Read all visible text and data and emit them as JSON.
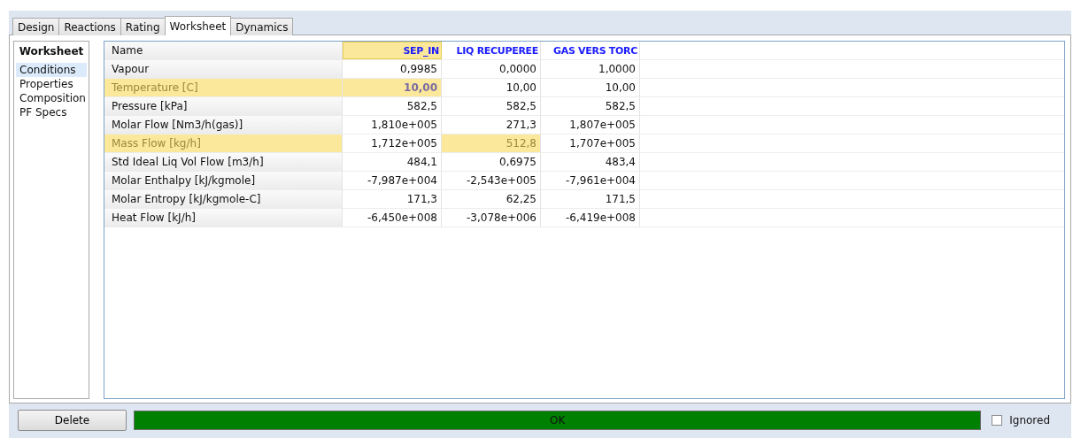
{
  "tabs": [
    {
      "label": "Design",
      "selected": false
    },
    {
      "label": "Reactions",
      "selected": false
    },
    {
      "label": "Rating",
      "selected": false
    },
    {
      "label": "Worksheet",
      "selected": true
    },
    {
      "label": "Dynamics",
      "selected": false
    }
  ],
  "sidebar": {
    "title": "Worksheet",
    "items": [
      {
        "label": "Conditions",
        "selected": true
      },
      {
        "label": "Properties",
        "selected": false
      },
      {
        "label": "Composition",
        "selected": false
      },
      {
        "label": "PF Specs",
        "selected": false
      }
    ]
  },
  "table": {
    "name_header": "Name",
    "columns": [
      {
        "label": "SEP_IN",
        "highlighted": true
      },
      {
        "label": "LIQ RECUPEREE",
        "highlighted": false
      },
      {
        "label": "GAS VERS TORC",
        "highlighted": false
      }
    ],
    "rows": [
      {
        "label": "Vapour",
        "highlighted": false,
        "cells": [
          {
            "value": "0,9985",
            "highlighted": false,
            "bold": false
          },
          {
            "value": "0,0000",
            "highlighted": false,
            "bold": false
          },
          {
            "value": "1,0000",
            "highlighted": false,
            "bold": false
          }
        ]
      },
      {
        "label": "Temperature [C]",
        "highlighted": true,
        "cells": [
          {
            "value": "10,00",
            "highlighted": true,
            "bold": true
          },
          {
            "value": "10,00",
            "highlighted": false,
            "bold": false
          },
          {
            "value": "10,00",
            "highlighted": false,
            "bold": false
          }
        ]
      },
      {
        "label": "Pressure [kPa]",
        "highlighted": false,
        "cells": [
          {
            "value": "582,5",
            "highlighted": false,
            "bold": false
          },
          {
            "value": "582,5",
            "highlighted": false,
            "bold": false
          },
          {
            "value": "582,5",
            "highlighted": false,
            "bold": false
          }
        ]
      },
      {
        "label": "Molar Flow [Nm3/h(gas)]",
        "highlighted": false,
        "cells": [
          {
            "value": "1,810e+005",
            "highlighted": false,
            "bold": false
          },
          {
            "value": "271,3",
            "highlighted": false,
            "bold": false
          },
          {
            "value": "1,807e+005",
            "highlighted": false,
            "bold": false
          }
        ]
      },
      {
        "label": "Mass Flow [kg/h]",
        "highlighted": true,
        "cells": [
          {
            "value": "1,712e+005",
            "highlighted": false,
            "bold": false
          },
          {
            "value": "512,8",
            "highlighted": true,
            "bold": false
          },
          {
            "value": "1,707e+005",
            "highlighted": false,
            "bold": false
          }
        ]
      },
      {
        "label": "Std Ideal Liq Vol Flow [m3/h]",
        "highlighted": false,
        "cells": [
          {
            "value": "484,1",
            "highlighted": false,
            "bold": false
          },
          {
            "value": "0,6975",
            "highlighted": false,
            "bold": false
          },
          {
            "value": "483,4",
            "highlighted": false,
            "bold": false
          }
        ]
      },
      {
        "label": "Molar Enthalpy [kJ/kgmole]",
        "highlighted": false,
        "cells": [
          {
            "value": "-7,987e+004",
            "highlighted": false,
            "bold": false
          },
          {
            "value": "-2,543e+005",
            "highlighted": false,
            "bold": false
          },
          {
            "value": "-7,961e+004",
            "highlighted": false,
            "bold": false
          }
        ]
      },
      {
        "label": "Molar Entropy [kJ/kgmole-C]",
        "highlighted": false,
        "cells": [
          {
            "value": "171,3",
            "highlighted": false,
            "bold": false
          },
          {
            "value": "62,25",
            "highlighted": false,
            "bold": false
          },
          {
            "value": "171,5",
            "highlighted": false,
            "bold": false
          }
        ]
      },
      {
        "label": "Heat Flow [kJ/h]",
        "highlighted": false,
        "cells": [
          {
            "value": "-6,450e+008",
            "highlighted": false,
            "bold": false
          },
          {
            "value": "-3,078e+006",
            "highlighted": false,
            "bold": false
          },
          {
            "value": "-6,419e+008",
            "highlighted": false,
            "bold": false
          }
        ]
      }
    ]
  },
  "footer": {
    "delete_button": "Delete",
    "status": "OK",
    "ignored": {
      "label": "Ignored",
      "checked": false
    }
  }
}
